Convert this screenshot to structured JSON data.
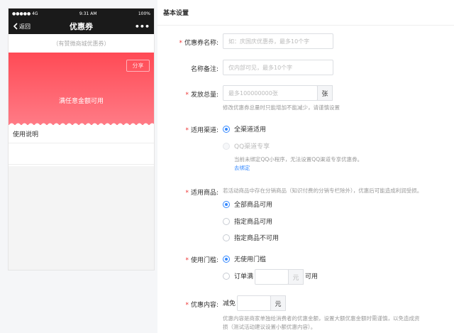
{
  "preview": {
    "status_left": "●●●●● 4G",
    "status_time": "9:31 AM",
    "status_right": "100%",
    "back_label": "返回",
    "title": "优惠券",
    "more": "•••",
    "shop_line": "（有赞微商城优惠券）",
    "share_label": "分享",
    "coupon_text": "满任意金额可用",
    "usage_label": "使用说明"
  },
  "form": {
    "section_title": "基本设置",
    "required_mark": "*",
    "name": {
      "label": "优惠券名称:",
      "placeholder": "如：庆国庆优惠券，最多10个字"
    },
    "remark": {
      "label": "名称备注:",
      "placeholder": "仅内部可见，最多10个字"
    },
    "quantity": {
      "label": "发放总量:",
      "placeholder": "最多100000000张",
      "unit": "张",
      "help": "修改优惠券总量时只能增加不能减少，请谨慎设置"
    },
    "channel": {
      "label": "适用渠道:",
      "options": [
        "全渠道适用",
        "QQ渠道专享"
      ],
      "selected": "全渠道适用",
      "qq_help": "当前未绑定QQ小程序，无法设置QQ渠道专享优惠券。",
      "bind_link": "去绑定"
    },
    "goods": {
      "label": "适用商品:",
      "note": "若活动商品中存在分销商品（知识付费的分销专栏除外），优惠后可能造成利润受损。",
      "options": [
        "全部商品可用",
        "指定商品可用",
        "指定商品不可用"
      ],
      "selected": "全部商品可用"
    },
    "threshold": {
      "label": "使用门槛:",
      "options": [
        "无使用门槛",
        "订单满"
      ],
      "selected": "无使用门槛",
      "unit": "元",
      "suffix": "可用"
    },
    "content": {
      "label": "优惠内容:",
      "prefix": "减免",
      "unit": "元",
      "help_line1": "优惠内容是商家单独给消费者的优惠金额，设置大额优惠金额时需谨慎，以免造成资",
      "help_line2": "损（测试活动建议设置小额优惠内容）。"
    }
  },
  "colors": {
    "accent": "#3388ff",
    "coupon_top": "#ff4a55",
    "coupon_bottom": "#ff7b86",
    "required": "#ee3333"
  }
}
